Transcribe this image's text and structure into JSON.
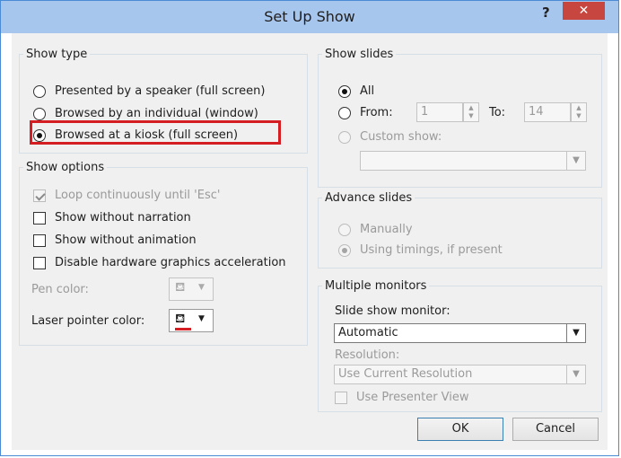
{
  "window": {
    "title": "Set Up Show",
    "help": "?",
    "close": "✕"
  },
  "show_type": {
    "legend": "Show type",
    "options": [
      {
        "label": "Presented by a speaker (full screen)",
        "selected": false
      },
      {
        "label": "Browsed by an individual (window)",
        "selected": false
      },
      {
        "label": "Browsed at a kiosk (full screen)",
        "selected": true
      }
    ]
  },
  "show_options": {
    "legend": "Show options",
    "checks": [
      {
        "label": "Loop continuously until 'Esc'",
        "checked": true,
        "disabled": true
      },
      {
        "label": "Show without narration",
        "checked": false
      },
      {
        "label": "Show without animation",
        "checked": false
      },
      {
        "label": "Disable hardware graphics acceleration",
        "checked": false
      }
    ],
    "pen_color_label": "Pen color:",
    "laser_color_label": "Laser pointer color:",
    "laser_color": "#d51d24"
  },
  "show_slides": {
    "legend": "Show slides",
    "all_label": "All",
    "from_label": "From:",
    "from_value": "1",
    "to_label": "To:",
    "to_value": "14",
    "custom_label": "Custom show:",
    "custom_value": ""
  },
  "advance_slides": {
    "legend": "Advance slides",
    "manually_label": "Manually",
    "timings_label": "Using timings, if present"
  },
  "monitors": {
    "legend": "Multiple monitors",
    "monitor_label": "Slide show monitor:",
    "monitor_value": "Automatic",
    "resolution_label": "Resolution:",
    "resolution_value": "Use Current Resolution",
    "presenter_view_label": "Use Presenter View"
  },
  "buttons": {
    "ok": "OK",
    "cancel": "Cancel"
  },
  "colors": {
    "titlebar": "#a7c6ee",
    "close": "#c7463f",
    "highlight": "#d51d24"
  }
}
